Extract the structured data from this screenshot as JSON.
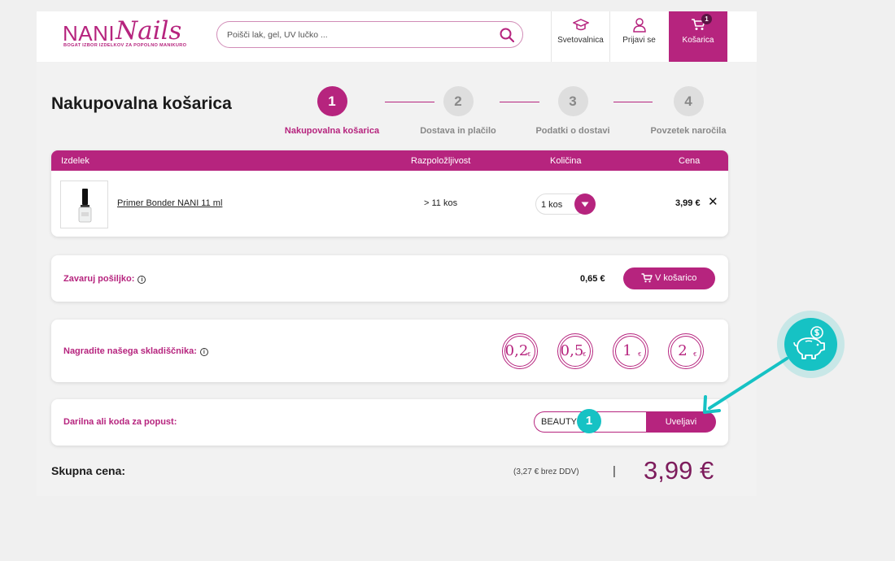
{
  "header": {
    "logo_brand": "NANI",
    "logo_script": "Nails",
    "logo_tagline": "BOGAT IZBOR IZDELKOV ZA POPOLNO MANIKURO",
    "search_placeholder": "Poišči lak, gel, UV lučko ...",
    "nav": {
      "academy_label": "Svetovalnica",
      "login_label": "Prijavi se",
      "cart_label": "Košarica",
      "cart_count": "1"
    }
  },
  "page_title": "Nakupovalna košarica",
  "steps": [
    {
      "number": "1",
      "label": "Nakupovalna košarica"
    },
    {
      "number": "2",
      "label": "Dostava in plačilo"
    },
    {
      "number": "3",
      "label": "Podatki o dostavi"
    },
    {
      "number": "4",
      "label": "Povzetek naročila"
    }
  ],
  "cart_table": {
    "columns": [
      "Izdelek",
      "Razpoložljivost",
      "Količina",
      "Cena"
    ],
    "rows": [
      {
        "product": "Primer Bonder NANI 11 ml",
        "availability": "> 11 kos",
        "quantity": "1 kos",
        "price": "3,99 €"
      }
    ]
  },
  "insurance": {
    "label": "Zavaruj pošiljko:",
    "price": "0,65 €",
    "button": "V košarico"
  },
  "reward": {
    "label": "Nagradite našega skladiščnika:",
    "tips": [
      {
        "value": "0,2",
        "currency": "€"
      },
      {
        "value": "0,5",
        "currency": "€"
      },
      {
        "value": "1",
        "currency": "€"
      },
      {
        "value": "2",
        "currency": "€"
      }
    ]
  },
  "discount": {
    "label": "Darilna ali koda za popust:",
    "value": "BEAUTY",
    "button": "Uveljavi",
    "marker": "1"
  },
  "total": {
    "label": "Skupna cena:",
    "net": "(3,27 € brez DDV)",
    "separator": "|",
    "price": "3,99 €"
  },
  "colors": {
    "brand": "#b6247e",
    "accent_teal": "#16c2c4",
    "total_price": "#7d1c5c"
  }
}
